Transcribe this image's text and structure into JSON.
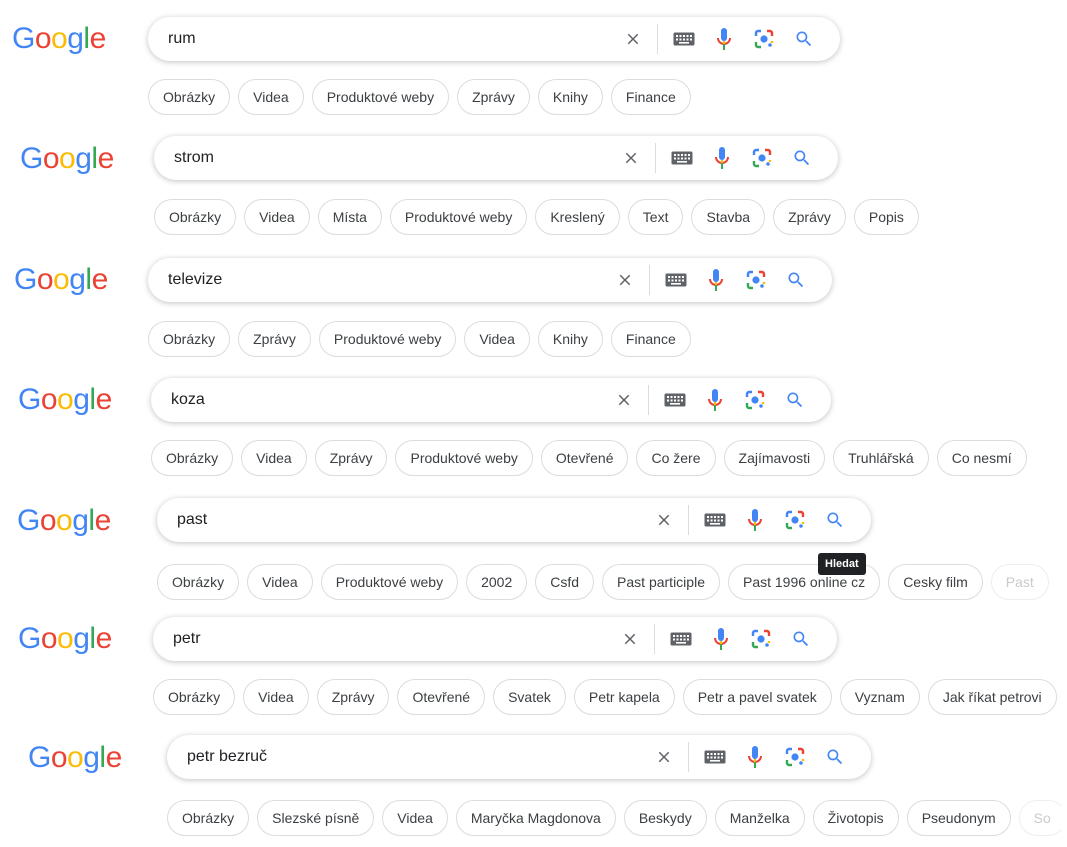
{
  "brand": {
    "logo_letters": [
      {
        "ch": "G",
        "color": "#4285F4"
      },
      {
        "ch": "o",
        "color": "#EA4335"
      },
      {
        "ch": "o",
        "color": "#FBBC05"
      },
      {
        "ch": "g",
        "color": "#4285F4"
      },
      {
        "ch": "l",
        "color": "#34A853"
      },
      {
        "ch": "e",
        "color": "#EA4335"
      }
    ]
  },
  "icons": [
    "clear-icon",
    "keyboard-icon",
    "microphone-icon",
    "lens-icon",
    "search-icon"
  ],
  "tooltip": {
    "search": "Hledat"
  },
  "searches": [
    {
      "query": "rum",
      "chips": [
        "Obrázky",
        "Videa",
        "Produktové weby",
        "Zprávy",
        "Knihy",
        "Finance"
      ]
    },
    {
      "query": "strom",
      "chips": [
        "Obrázky",
        "Videa",
        "Místa",
        "Produktové weby",
        "Kreslený",
        "Text",
        "Stavba",
        "Zprávy",
        "Popis"
      ]
    },
    {
      "query": "televize",
      "chips": [
        "Obrázky",
        "Zprávy",
        "Produktové weby",
        "Videa",
        "Knihy",
        "Finance"
      ]
    },
    {
      "query": "koza",
      "chips": [
        "Obrázky",
        "Videa",
        "Zprávy",
        "Produktové weby",
        "Otevřené",
        "Co žere",
        "Zajímavosti",
        "Truhlářská",
        "Co nesmí"
      ]
    },
    {
      "query": "past",
      "chips": [
        "Obrázky",
        "Videa",
        "Produktové weby",
        "2002",
        "Csfd",
        "Past participle",
        "Past 1996 online cz",
        "Cesky film",
        "Past"
      ]
    },
    {
      "query": "petr",
      "chips": [
        "Obrázky",
        "Videa",
        "Zprávy",
        "Otevřené",
        "Svatek",
        "Petr kapela",
        "Petr a pavel svatek",
        "Vyznam",
        "Jak říkat petrovi"
      ]
    },
    {
      "query": "petr bezruč",
      "chips": [
        "Obrázky",
        "Slezské písně",
        "Videa",
        "Maryčka Magdonova",
        "Beskydy",
        "Manželka",
        "Životopis",
        "Pseudonym",
        "So"
      ]
    }
  ]
}
